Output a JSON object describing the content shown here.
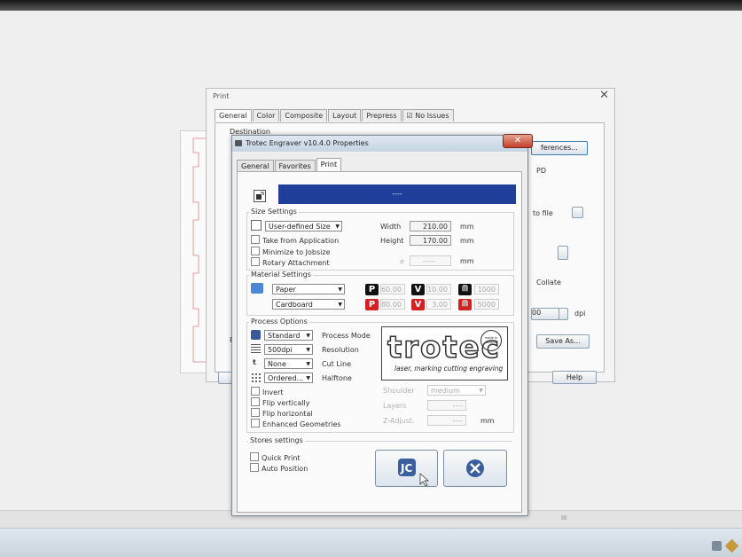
{
  "print_dialog": {
    "title": "Print",
    "close_glyph": "✕",
    "tabs": [
      "General",
      "Color",
      "Composite",
      "Layout",
      "Prepress",
      "No Issues"
    ],
    "section_label": "Destination",
    "preferences_label": "ferences...",
    "pdf_label": "PD",
    "to_file_label": "to file",
    "collate_label": "Collate",
    "dpi_label": "dpi",
    "dpi_value": "00",
    "save_as_label": "Save As...",
    "help_label": "Help",
    "left_letter": "R"
  },
  "trotec_dialog": {
    "title": "Trotec Engraver v10.4.0 Properties",
    "close_glyph": "✕",
    "tabs": [
      "General",
      "Favorites",
      "Print"
    ],
    "banner_text": "----",
    "size_settings": {
      "title": "Size Settings",
      "size_select": "User-defined Size",
      "width_label": "Width",
      "width_value": "210.00",
      "height_label": "Height",
      "height_value": "170.00",
      "unit": "mm",
      "take_from_app": "Take from Application",
      "minimize": "Minimize to Jobsize",
      "rotary": "Rotary Attachment",
      "diameter_symbol": "⌀",
      "diameter_value": "-----",
      "diameter_unit": "mm"
    },
    "material_settings": {
      "title": "Material Settings",
      "material": "Paper",
      "submaterial": "Cardboard",
      "row1": {
        "p": "60.00",
        "v": "10.00",
        "w": "1000"
      },
      "row2": {
        "p": "80.00",
        "v": "3.00",
        "w": "5000"
      },
      "p_letter": "P",
      "v_letter": "V",
      "w_letter": "ᗰ"
    },
    "process_options": {
      "title": "Process Options",
      "process_mode_value": "Standard",
      "process_mode_label": "Process Mode",
      "resolution_value": "500dpi",
      "resolution_label": "Resolution",
      "cutline_value": "None",
      "cutline_label": "Cut Line",
      "halftone_value": "Ordered...",
      "halftone_label": "Halftone",
      "invert": "Invert",
      "flip_v": "Flip vertically",
      "flip_h": "Flip horizontal",
      "enhanced": "Enhanced Geometries",
      "shoulder_label": "Shoulder",
      "shoulder_value": "medium",
      "layers_label": "Layers",
      "layers_value": "----",
      "zadjust_label": "Z-Adjust.",
      "zadjust_value": "----",
      "zadjust_unit": "mm"
    },
    "logo": {
      "word": "trotec",
      "tagline": "laser, marking cutting engraving",
      "seal": "made in austria"
    },
    "stores_settings": {
      "title": "Stores settings",
      "quick_print": "Quick Print",
      "auto_position": "Auto Position"
    }
  },
  "colors": {
    "banner": "#1f3f9a",
    "badge_p": "#d32020",
    "badge_black": "#111111",
    "cancel_blue": "#3b5f9e"
  }
}
